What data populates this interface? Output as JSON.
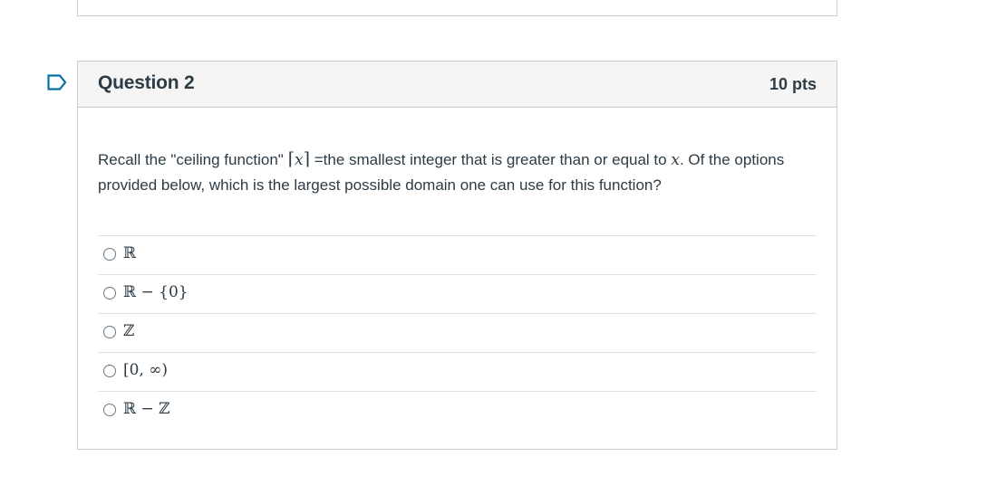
{
  "question": {
    "title": "Question 2",
    "points": "10 pts",
    "text_part1": "Recall the \"ceiling function\" ",
    "ceil_left": "⌈",
    "ceil_var": "x",
    "ceil_right": "⌉",
    "text_part2": " =the smallest integer that is greater than or equal to ",
    "text_var": "x",
    "text_part3": ". Of the options provided below, which is the largest possible domain one can use for this function?"
  },
  "answers": [
    {
      "label": "ℝ"
    },
    {
      "label": "ℝ − {0}"
    },
    {
      "label": "ℤ"
    },
    {
      "label": "[0, ∞)"
    },
    {
      "label": "ℝ − ℤ"
    }
  ],
  "icons": {
    "flag": "bookmark-flag-icon"
  },
  "colors": {
    "header_bg": "#f5f5f5",
    "border": "#c7cdd1",
    "text": "#2d3b45",
    "flag": "#0770a3"
  }
}
